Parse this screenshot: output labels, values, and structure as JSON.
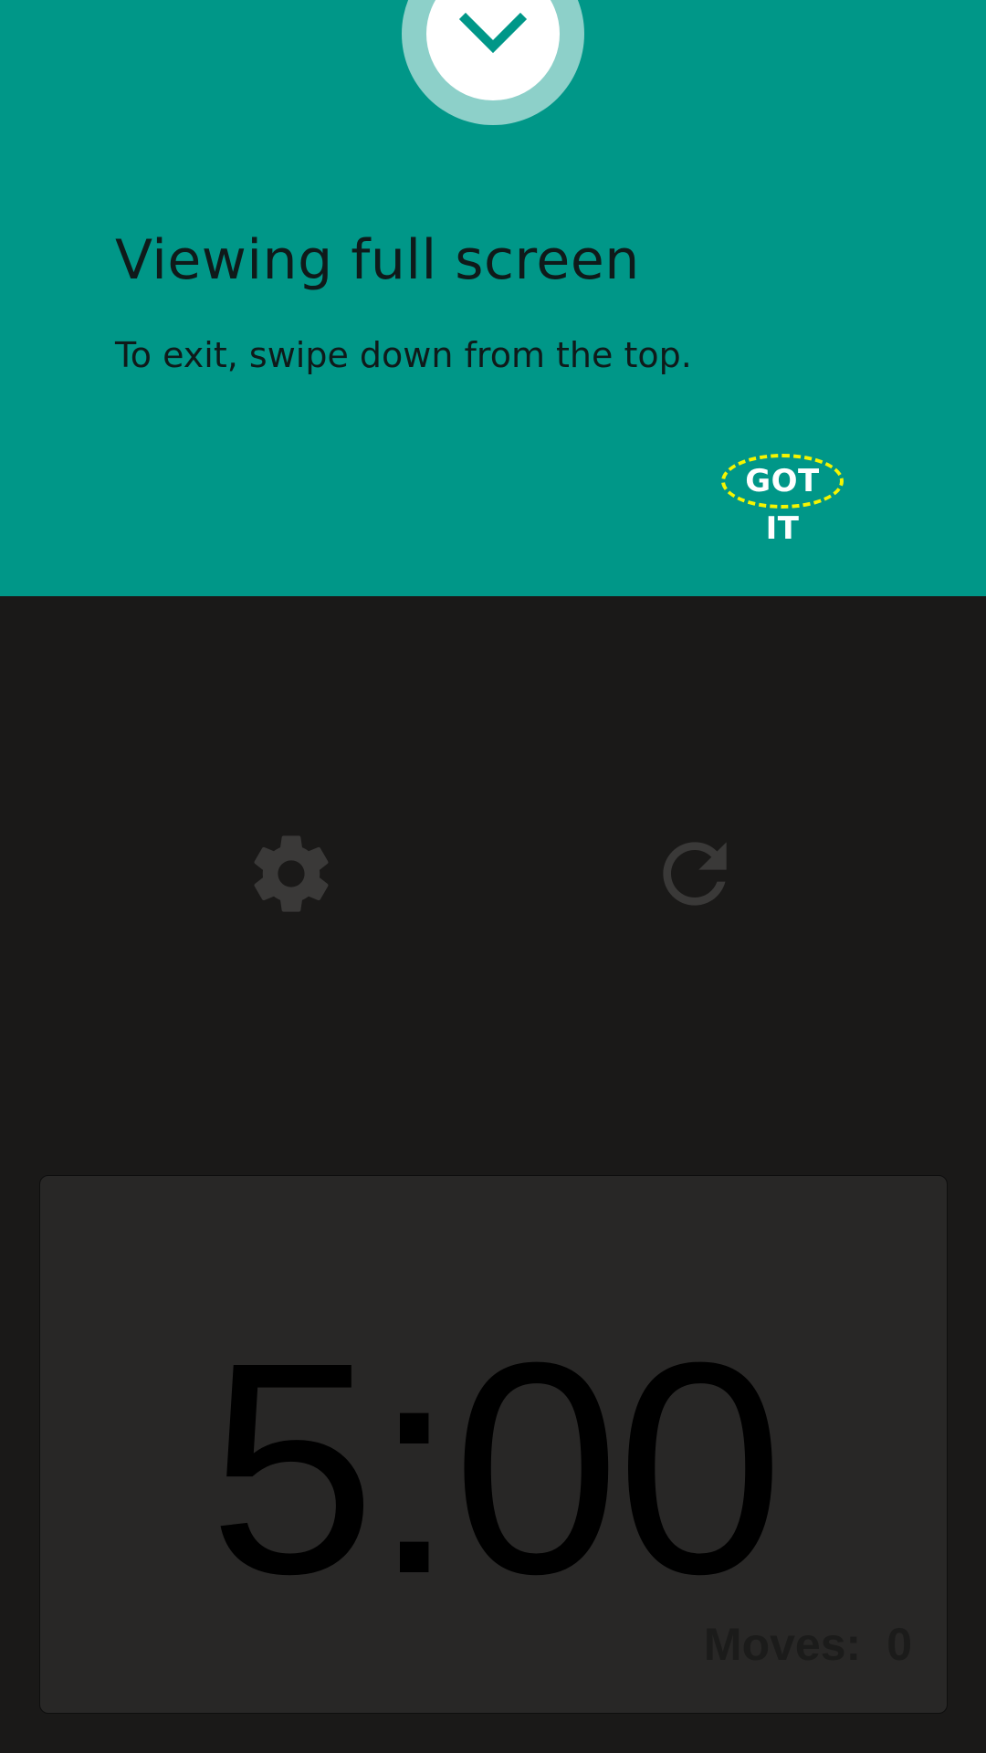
{
  "banner": {
    "title": "Viewing full screen",
    "body": "To exit, swipe down from the top.",
    "dismiss_label": "GOT IT",
    "icon": "chevron-down-icon",
    "accent_color": "#009788"
  },
  "controls": {
    "settings_icon": "gear-icon",
    "reset_icon": "refresh-icon"
  },
  "timer": {
    "value": "5:00",
    "moves_label": "Moves:",
    "moves_count": "0"
  }
}
